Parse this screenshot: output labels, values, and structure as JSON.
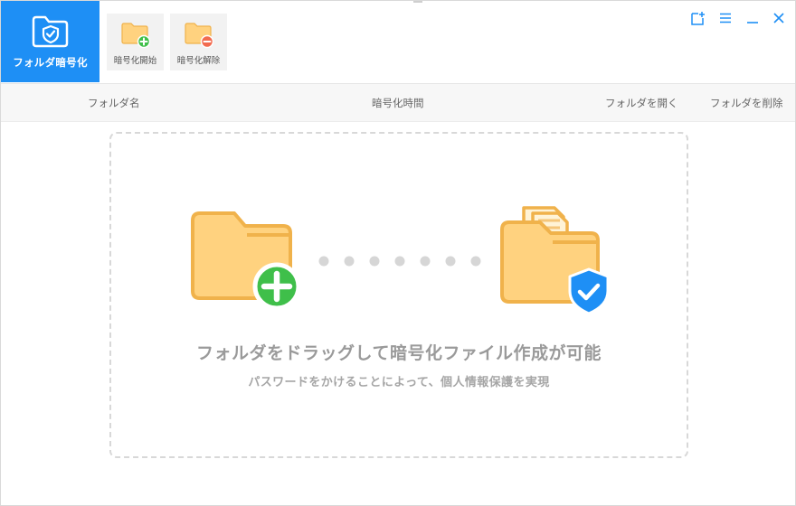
{
  "toolbar": {
    "main_tab_label": "フォルダ暗号化",
    "encrypt_start_label": "暗号化開始",
    "decrypt_label": "暗号化解除"
  },
  "window_controls": [
    "add-window-icon",
    "menu-icon",
    "minimize-icon",
    "close-icon"
  ],
  "table": {
    "columns": [
      "フォルダ名",
      "暗号化時間",
      "フォルダを開く",
      "フォルダを削除"
    ]
  },
  "dropzone": {
    "title": "フォルダをドラッグして暗号化ファイル作成が可能",
    "subtitle": "パスワードをかけることによって、個人情報保護を実現"
  },
  "colors": {
    "accent": "#1e8ff5",
    "folder": "#ffd27f",
    "folder_edge": "#f0b24b",
    "add_green": "#3fbf4a",
    "remove_red": "#f26b4f",
    "shield_blue": "#1e8ff5"
  }
}
